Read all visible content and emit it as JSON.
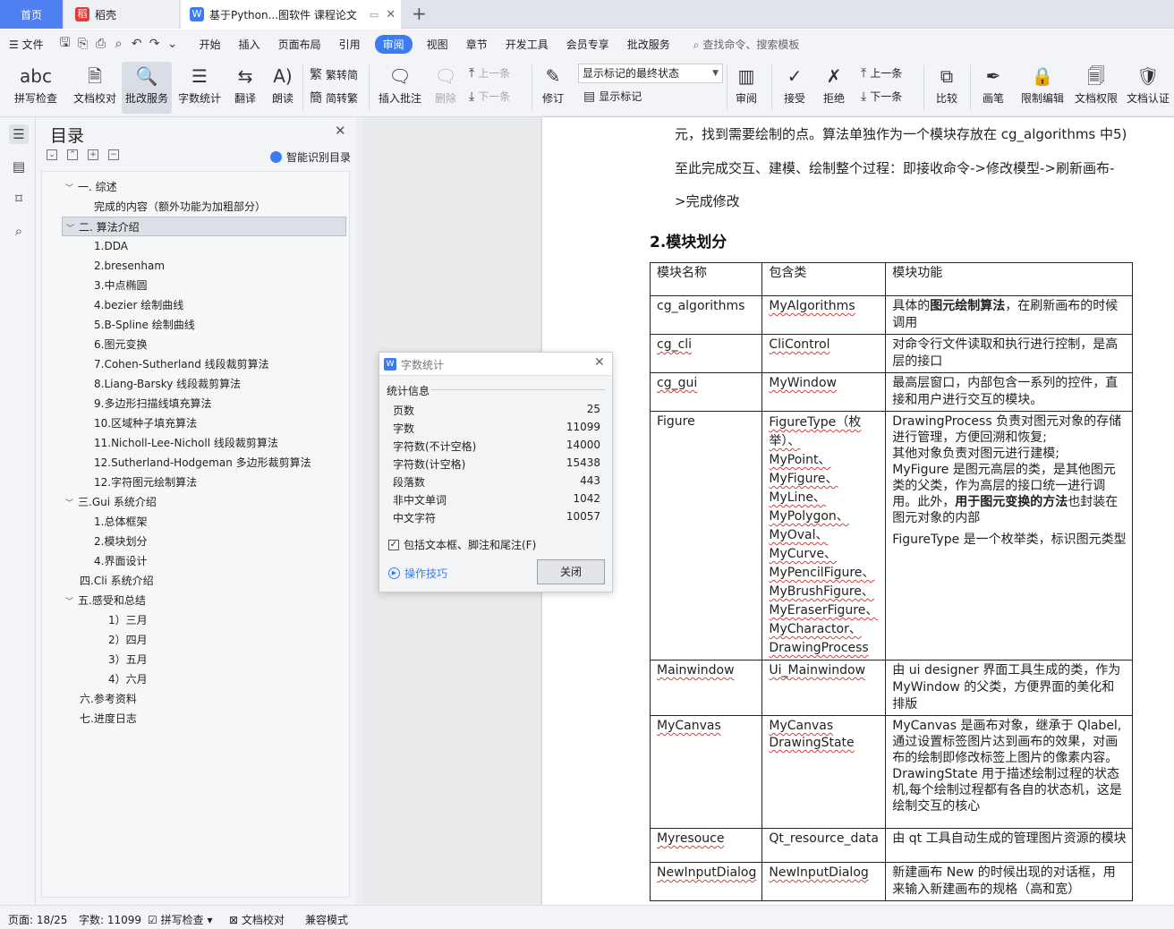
{
  "tabs": {
    "home": "首页",
    "daoke": "稻壳",
    "doc": "基于Python...图软件 课程论文"
  },
  "menu": {
    "file": "文件",
    "items": [
      "开始",
      "插入",
      "页面布局",
      "引用",
      "审阅",
      "视图",
      "章节",
      "开发工具",
      "会员专享",
      "批改服务"
    ],
    "search": "查找命令、搜索模板"
  },
  "ribbon": {
    "spell": "拼写检查",
    "doccheck": "文档校对",
    "review_service": "批改服务",
    "wordcount": "字数统计",
    "translate": "翻译",
    "read": "朗读",
    "trad": "繁转简",
    "simp": "简转繁",
    "insert_comment": "插入批注",
    "delete": "删除",
    "prev": "上一条",
    "next": "下一条",
    "track": "修订",
    "markup_state": "显示标记的最终状态",
    "show_markup": "显示标记",
    "review_pane": "审阅",
    "accept": "接受",
    "reject": "拒绝",
    "prev2": "上一条",
    "next2": "下一条",
    "compare": "比较",
    "pen": "画笔",
    "restrict": "限制编辑",
    "permission": "文档权限",
    "cert": "文档认证"
  },
  "toc": {
    "title": "目录",
    "smart": "智能识别目录",
    "items": [
      "一. 综述",
      "完成的内容（额外功能为加粗部分）",
      "二. 算法介绍",
      "1.DDA",
      "2.bresenham",
      "3.中点椭圆",
      "4.bezier 绘制曲线",
      "5.B-Spline 绘制曲线",
      "6.图元变换",
      "7.Cohen-Sutherland 线段裁剪算法",
      "8.Liang-Barsky 线段裁剪算法",
      "9.多边形扫描线填充算法",
      "10.区域种子填充算法",
      "11.Nicholl-Lee-Nicholl 线段裁剪算法",
      "12.Sutherland-Hodgeman 多边形裁剪算法",
      "12.字符图元绘制算法",
      "三.Gui 系统介绍",
      "1.总体框架",
      "2.模块划分",
      "4.界面设计",
      "四.Cli 系统介绍",
      "五.感受和总结",
      "1）三月",
      "2）四月",
      "3）五月",
      "4）六月",
      "六.参考资料",
      "七.进度日志"
    ]
  },
  "doc": {
    "p1": "元，找到需要绘制的点。算法单独作为一个模块存放在 cg_algorithms 中5)",
    "p2": "至此完成交互、建模、绘制整个过程：即接收命令->修改模型->刷新画布-",
    "p3": ">完成修改",
    "h2": "2.模块划分",
    "table": {
      "head": [
        "模块名称",
        "包含类",
        "模块功能"
      ],
      "r1": [
        "cg_algorithms",
        "MyAlgorithms",
        "具体的",
        "图元绘制算法",
        "，在刷新画布的时候调用"
      ],
      "r2": [
        "cg_cli",
        "CliControl",
        "对命令行文件读取和执行进行控制，是高层的接口"
      ],
      "r3": [
        "cg_gui",
        "MyWindow",
        "最高层窗口，内部包含一系列的控件，直接和用户进行交互的模块。"
      ],
      "r4_name": "Figure",
      "r4_classes": [
        "FigureType（枚举）、",
        "MyPoint、",
        "MyFigure、MyLine、",
        "MyPolygon、",
        "MyOval、MyCurve、",
        "MyPencilFigure、",
        "MyBrushFigure、",
        "MyEraserFigure、",
        "MyCharactor、",
        "DrawingProcess"
      ],
      "r4_f1": "DrawingProcess 负责对图元对象的存储进行管理，方便回溯和恢复;",
      "r4_f2": "其他对象负责对图元进行建模;",
      "r4_f3a": "MyFigure 是图元高层的类，是其他图元类的父类，作为高层的接口统一进行调用。此外，",
      "r4_f3b": "用于图元变换的方法",
      "r4_f3c": "也封装在图元对象的内部",
      "r4_f4": "FigureType 是一个枚举类，标识图元类型",
      "r5": [
        "Mainwindow",
        "Ui_Mainwindow",
        "由 ui designer 界面工具生成的类，作为 MyWindow 的父类，方便界面的美化和排版"
      ],
      "r6_name": "MyCanvas",
      "r6_classes": [
        "MyCanvas",
        "DrawingState"
      ],
      "r6_f1": "MyCanvas 是画布对象，继承于 Qlabel,通过设置标签图片达到画布的效果，对画布的绘制即修改标签上图片的像素内容。",
      "r6_f2": "DrawingState 用于描述绘制过程的状态机,每个绘制过程都有各自的状态机，这是绘制交互的核心",
      "r7": [
        "Myresouce",
        "Qt_resource_data",
        "由 qt 工具自动生成的管理图片资源的模块"
      ],
      "r8": [
        "NewInputDialog",
        "NewInputDialog",
        "新建画布 New 的时候出现的对话框，用来输入新建画布的规格（高和宽）"
      ]
    }
  },
  "dialog": {
    "title": "字数统计",
    "section": "统计信息",
    "rows": [
      [
        "页数",
        "25"
      ],
      [
        "字数",
        "11099"
      ],
      [
        "字符数(不计空格)",
        "14000"
      ],
      [
        "字符数(计空格)",
        "15438"
      ],
      [
        "段落数",
        "443"
      ],
      [
        "非中文单词",
        "1042"
      ],
      [
        "中文字符",
        "10057"
      ]
    ],
    "checkbox": "包括文本框、脚注和尾注(F)",
    "tips": "操作技巧",
    "close": "关闭"
  },
  "status": {
    "page": "页面: 18/25",
    "words": "字数: 11099",
    "spell": "拼写检查",
    "check": "文档校对",
    "compat": "兼容模式"
  }
}
